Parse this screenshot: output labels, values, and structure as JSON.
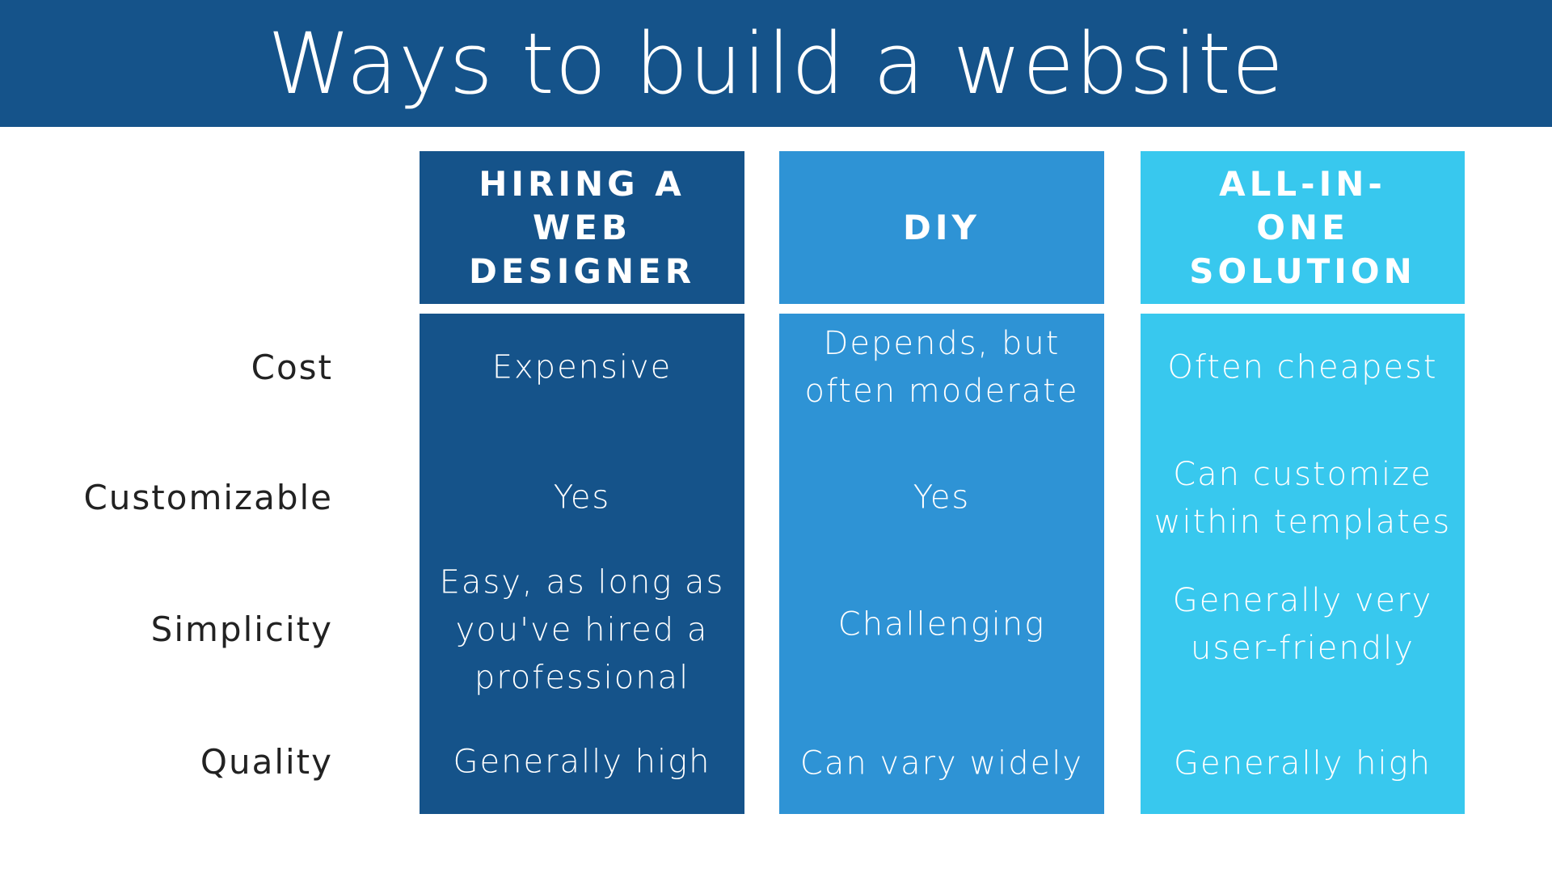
{
  "title": "Ways to build a website",
  "colors": {
    "title_bar": "#15538A",
    "column_1": "#15538A",
    "column_2": "#2E93D5",
    "column_3": "#38C8EE",
    "label_text": "#222222",
    "cell_text": "#FFFFFF"
  },
  "columns": [
    {
      "header_lines": [
        "HIRING A",
        "WEB",
        "DESIGNER"
      ]
    },
    {
      "header_lines": [
        "DIY"
      ]
    },
    {
      "header_lines": [
        "ALL-IN-",
        "ONE",
        "SOLUTION"
      ]
    }
  ],
  "rows": [
    {
      "label": "Cost",
      "cells": [
        [
          "Expensive"
        ],
        [
          "Depends, but",
          "often moderate"
        ],
        [
          "Often cheapest"
        ]
      ]
    },
    {
      "label": "Customizable",
      "cells": [
        [
          "Yes"
        ],
        [
          "Yes"
        ],
        [
          "Can customize",
          "within templates"
        ]
      ]
    },
    {
      "label": "Simplicity",
      "cells": [
        [
          "Easy, as long as",
          "you've hired a",
          "professional"
        ],
        [
          "Challenging"
        ],
        [
          "Generally very",
          "user-friendly"
        ]
      ]
    },
    {
      "label": "Quality",
      "cells": [
        [
          "Generally high"
        ],
        [
          "Can vary widely"
        ],
        [
          "Generally high"
        ]
      ]
    }
  ]
}
